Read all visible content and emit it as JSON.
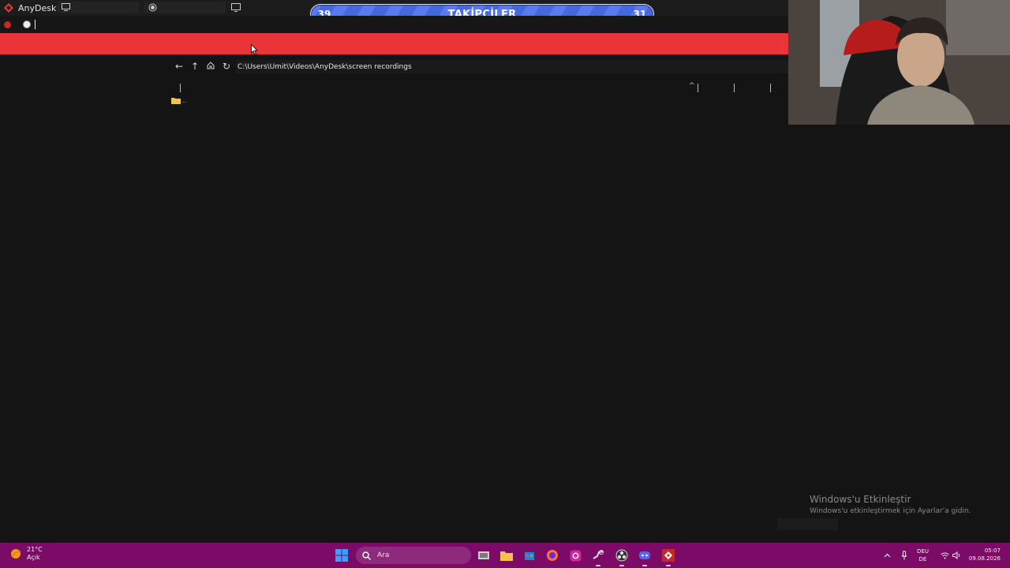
{
  "app": {
    "name": "AnyDesk"
  },
  "follower_bar": {
    "left_count": "39",
    "label": "TAKİPÇİLER",
    "right_count": "31"
  },
  "explorer": {
    "path": "C:\\Users\\Ümit\\Videos\\AnyDesk\\screen recordings",
    "file_name": ".."
  },
  "watermark": {
    "title": "Windows'u Etkinleştir",
    "subtitle": "Windows'u etkinleştirmek için Ayarlar'a gidin."
  },
  "taskbar": {
    "weather_temp": "21°C",
    "weather_desc": "Açık",
    "search_placeholder": "Ara",
    "lang_line1": "DEU",
    "lang_line2": "DE",
    "time": "05:07",
    "date": "09.08.2026"
  },
  "colors": {
    "anydesk_red": "#ea3438",
    "taskbar": "#7c0b67",
    "follower_blue": "#4668de"
  }
}
